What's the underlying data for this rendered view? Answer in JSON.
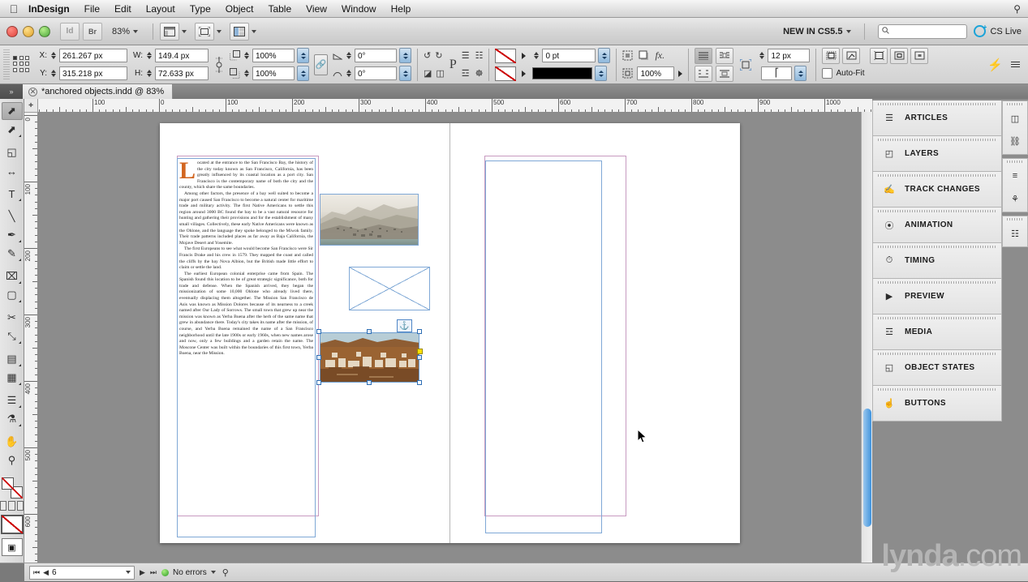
{
  "menubar": {
    "apple_icon": "apple-icon",
    "items": [
      {
        "label": "InDesign",
        "bold": true
      },
      {
        "label": "File"
      },
      {
        "label": "Edit"
      },
      {
        "label": "Layout"
      },
      {
        "label": "Type"
      },
      {
        "label": "Object"
      },
      {
        "label": "Table"
      },
      {
        "label": "View"
      },
      {
        "label": "Window"
      },
      {
        "label": "Help"
      }
    ],
    "spotlight_icon": "search-icon"
  },
  "appbar": {
    "app_badge": "Id",
    "bridge_badge": "Br",
    "zoom_level": "83%",
    "view_options_icon": "view-options-icon",
    "screen_mode_icon": "screen-mode-icon",
    "arrange_docs_icon": "arrange-documents-icon",
    "new_in_label": "NEW IN CS5.5",
    "search_placeholder": "",
    "search_value": "",
    "cs_live_label": "CS Live"
  },
  "control_bar": {
    "x_label": "X:",
    "x_value": "261.267 px",
    "y_label": "Y:",
    "y_value": "315.218 px",
    "w_label": "W:",
    "w_value": "149.4 px",
    "h_label": "H:",
    "h_value": "72.633 px",
    "scale_x_value": "100%",
    "scale_y_value": "100%",
    "rotation_value": "0°",
    "shear_value": "0°",
    "stroke_weight": "0 pt",
    "opacity_value": "100%",
    "text_wrap_offset": "12 px",
    "auto_fit_label": "Auto-Fit",
    "auto_fit_checked": false,
    "constrain_icon": "chain-link-icon",
    "flip_icon": "flip-icon",
    "reference_point_icon": "reference-point-selector"
  },
  "document_tab": {
    "title": "*anchored objects.indd @ 83%",
    "close_icon": "close-icon"
  },
  "rulers": {
    "horizontal_ticks": [
      "0",
      "100",
      "0",
      "100",
      "200",
      "300",
      "400",
      "500",
      "600",
      "700",
      "800",
      "900",
      "1000"
    ],
    "vertical_ticks": [
      "0",
      "100",
      "200",
      "300",
      "400",
      "500",
      "600"
    ],
    "units": "px"
  },
  "tools": [
    {
      "name": "selection-tool",
      "glyph": "⬈",
      "selected": true
    },
    {
      "name": "direct-selection-tool",
      "glyph": "⬈",
      "selected": false
    },
    {
      "name": "page-tool",
      "glyph": "◱",
      "selected": false
    },
    {
      "name": "gap-tool",
      "glyph": "↔",
      "selected": false
    },
    {
      "name": "type-tool",
      "glyph": "T",
      "selected": false
    },
    {
      "name": "line-tool",
      "glyph": "╲",
      "selected": false
    },
    {
      "name": "pen-tool",
      "glyph": "✒",
      "selected": false
    },
    {
      "name": "pencil-tool",
      "glyph": "✎",
      "selected": false
    },
    {
      "name": "rectangle-frame-tool",
      "glyph": "⌧",
      "selected": false
    },
    {
      "name": "rectangle-tool",
      "glyph": "▢",
      "selected": false
    },
    {
      "name": "scissors-tool",
      "glyph": "✂",
      "selected": false
    },
    {
      "name": "free-transform-tool",
      "glyph": "⤡",
      "selected": false
    },
    {
      "name": "gradient-swatch-tool",
      "glyph": "▤",
      "selected": false
    },
    {
      "name": "gradient-feather-tool",
      "glyph": "▦",
      "selected": false
    },
    {
      "name": "note-tool",
      "glyph": "☰",
      "selected": false
    },
    {
      "name": "eyedropper-tool",
      "glyph": "⚗",
      "selected": false
    },
    {
      "name": "hand-tool",
      "glyph": "✋",
      "selected": false
    },
    {
      "name": "zoom-tool",
      "glyph": "⚲",
      "selected": false
    }
  ],
  "document": {
    "drop_cap": "L",
    "paragraphs": [
      "ocated at the entrance to the San Francisco Bay, the history of the city today known as San Francisco, California, has been greatly influenced by its coastal location as a port city. San Francisco is the contemporary name of both the city and the county, which share the same boundaries.",
      "Among other factors, the presence of a bay well suited to become a major port caused San Francisco to become a natural center for maritime trade and military activity. The first Native Americans to settle this region around 3000 BC found the bay to be a vast natural resource for hunting and gathering their provisions and for the establishment of many small villages. Collectively, these early Native Americans were known as the Ohlone, and the language they spoke belonged to the Miwok family. Their trade patterns included places as far away as Baja California, the Mojave Desert and Yosemite.",
      "The first Europeans to see what would become San Francisco were Sir Francis Drake and his crew in 1579. They mapped the coast and called the cliffs by the bay Nova Albion, but the British made little effort to claim or settle the land.",
      "The earliest European colonial enterprise came from Spain. The Spanish found this location to be of great strategic significance, both for trade and defense. When the Spanish arrived, they began the missionization of some 10,000 Ohlone who already lived there, eventually displacing them altogether. The Mission San Francisco de Asis was known as Mission Dolores because of its nearness to a creek named after Our Lady of Sorrows. The small town that grew up near the mission was known as Yerba Buena after the herb of the same name that grew in abundance there. Today's city takes its name after the mission, of course, and Yerba Buena remained the name of a San Francisco neighborhood until the late 1900s or early 1960s, when new names arose and now, only a few buildings and a garden retain the name. The Moscone Center was built within the boundaries of this first town, Yerba Buena, near the Mission."
    ],
    "objects": [
      {
        "name": "photo-landscape-engraving",
        "type": "image",
        "selected": false
      },
      {
        "name": "empty-graphic-frame",
        "type": "empty-frame",
        "selected": false
      },
      {
        "name": "photo-mission-town",
        "type": "anchored-image",
        "selected": true,
        "anchor_badge_icon": "anchor-icon"
      },
      {
        "name": "right-page-text-frame",
        "type": "frame",
        "selected": false
      }
    ]
  },
  "status_bar": {
    "page_number": "6",
    "first_page_icon": "first-page-icon",
    "prev_page_icon": "previous-page-icon",
    "next_page_icon": "next-page-icon",
    "last_page_icon": "last-page-icon",
    "preflight_status": "No errors",
    "status_color": "#2f9a26",
    "preflight_icon": "preflight-icon"
  },
  "dock": {
    "panels": [
      {
        "label": "ARTICLES",
        "icon": "articles-icon"
      },
      {
        "label": "LAYERS",
        "icon": "layers-icon"
      },
      {
        "label": "TRACK CHANGES",
        "icon": "track-changes-icon"
      },
      {
        "label": "ANIMATION",
        "icon": "animation-icon"
      },
      {
        "label": "TIMING",
        "icon": "timing-icon"
      },
      {
        "label": "PREVIEW",
        "icon": "preview-icon"
      },
      {
        "label": "MEDIA",
        "icon": "media-icon"
      },
      {
        "label": "OBJECT STATES",
        "icon": "object-states-icon"
      },
      {
        "label": "BUTTONS",
        "icon": "buttons-icon"
      }
    ],
    "icon_groups": [
      {
        "icons": [
          "pages-icon",
          "links-icon"
        ]
      },
      {
        "icons": [
          "paragraph-styles-icon",
          "swatches-icon"
        ]
      },
      {
        "icons": [
          "table-icon"
        ]
      }
    ]
  },
  "watermark": {
    "bold": "lynda",
    "light": ".com"
  },
  "colors": {
    "accent_blue": "#3f93dd",
    "selection_blue": "#2f6fb5",
    "drop_cap_orange": "#d2651f",
    "margin_magenta": "#c79ac0",
    "status_green": "#2f9a26",
    "pasteboard_gray": "#8c8c8c"
  }
}
